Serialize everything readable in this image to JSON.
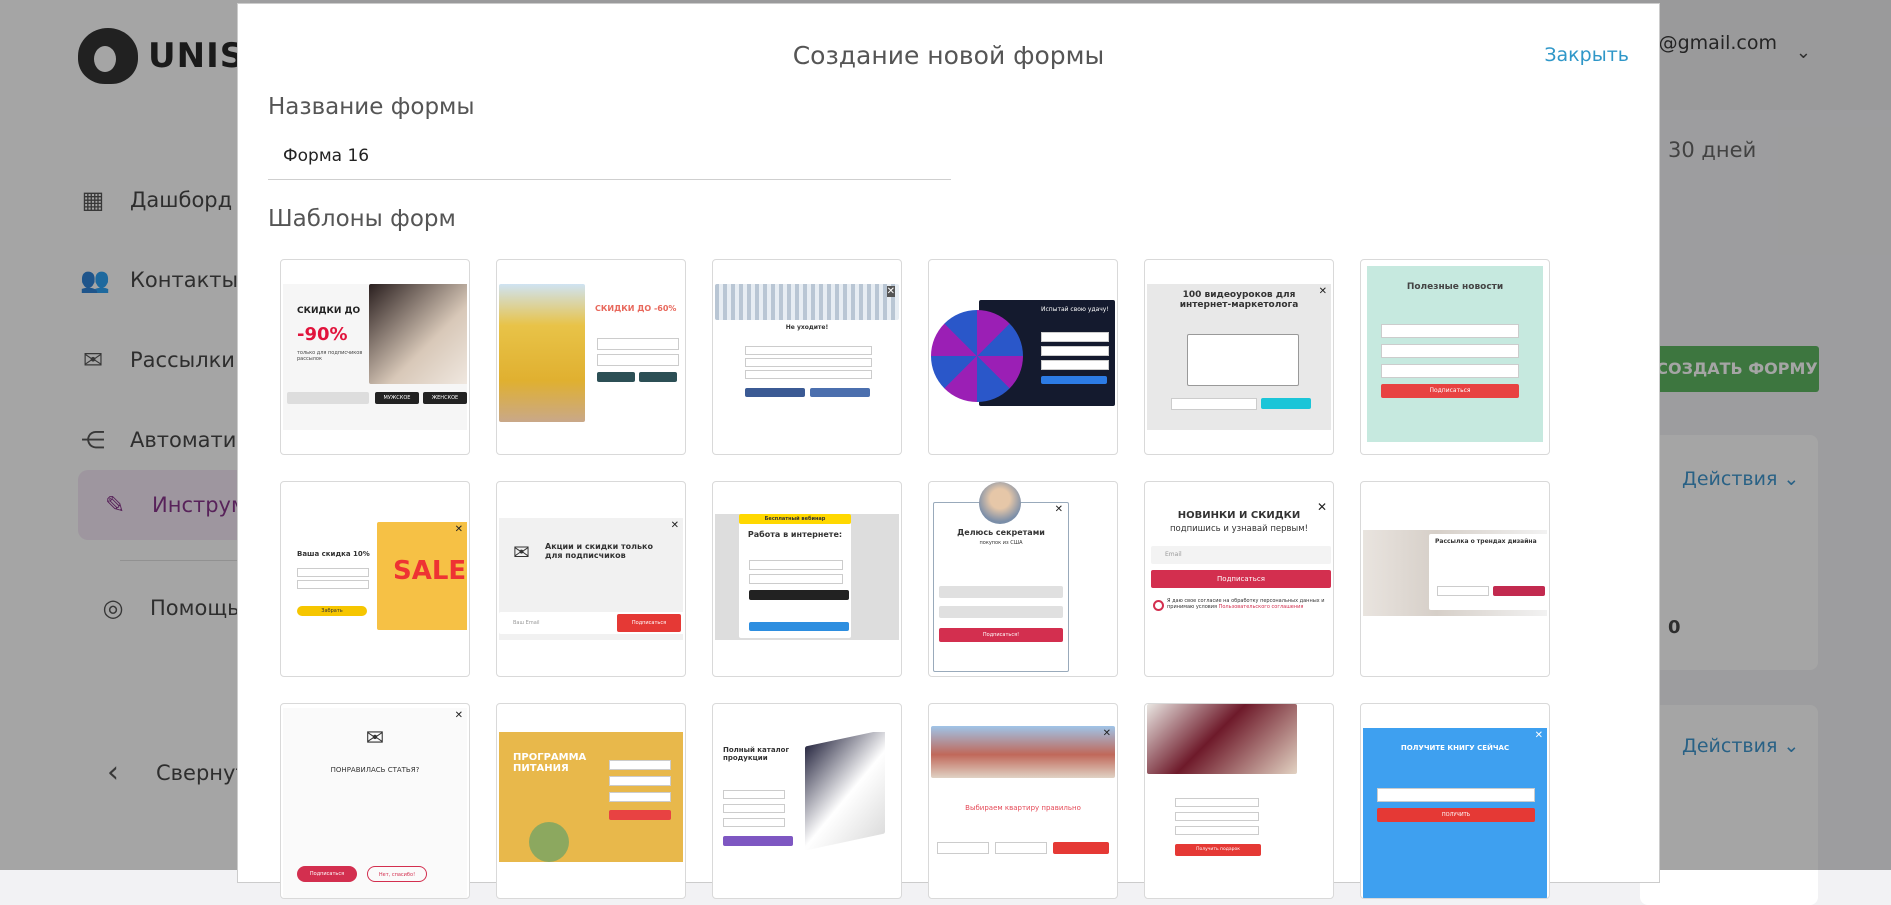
{
  "app": {
    "logo_text": "UNIS",
    "nav": [
      {
        "label": "Дашборд",
        "icon": "grid-icon"
      },
      {
        "label": "Контакты",
        "icon": "contacts-icon"
      },
      {
        "label": "Рассылки",
        "icon": "mail-icon"
      },
      {
        "label": "Автомати",
        "icon": "automation-icon"
      },
      {
        "label": "Инструм",
        "icon": "tools-icon"
      }
    ],
    "help_label": "Помощь",
    "collapse_label": "Свернут",
    "user_email": "ry@gmail.com",
    "period": "30 дней",
    "create_button": "СОЗДАТЬ ФОРМУ",
    "actions_label": "Действия",
    "zero_value": "0"
  },
  "modal": {
    "title": "Создание новой формы",
    "close_label": "Закрыть",
    "name_label": "Название формы",
    "name_value": "Форма 16",
    "templates_label": "Шаблоны форм"
  },
  "templates": {
    "t1": {
      "title": "СКИДКИ ДО",
      "percent": "-90%",
      "sub": "только для подписчиков рассылок",
      "btn1": "МУЖСКОЕ",
      "btn2": "ЖЕНСКОЕ"
    },
    "t2": {
      "title": "СКИДКИ ДО -60%"
    },
    "t3": {
      "title": "Не уходите!"
    },
    "t4": {
      "title": "Испытай свою удачу!"
    },
    "t5": {
      "title": "100 видеоуроков для интернет-маркетолога"
    },
    "t6": {
      "title": "Полезные новости",
      "btn": "Подписаться"
    },
    "t7": {
      "title": "Ваша скидка 10%",
      "sale": "SALE",
      "btn": "Забрать"
    },
    "t8": {
      "title": "Акции и скидки только для подписчиков",
      "placeholder": "Ваш Email",
      "btn": "Подписаться"
    },
    "t9": {
      "banner": "Бесплатный вебинар",
      "title": "Работа в интернете:"
    },
    "t10": {
      "title": "Делюсь секретами",
      "sub": "покупок из США",
      "btn": "Подписаться!"
    },
    "t11": {
      "title": "НОВИНКИ И СКИДКИ",
      "sub": "подпишись и узнавай первым!",
      "placeholder": "Email",
      "btn": "Подписаться",
      "consent": "Я даю свое согласие на обработку персональных данных и принимаю условия",
      "consent_link": "Пользовательского соглашения"
    },
    "t12": {
      "title": "Рассылка о трендах дизайна"
    },
    "t13": {
      "title": "ПОНРАВИЛАСЬ СТАТЬЯ?",
      "btn1": "Подписаться",
      "btn2": "Нет, спасибо!"
    },
    "t14": {
      "title": "ПРОГРАММА ПИТАНИЯ"
    },
    "t15": {
      "title": "Полный каталог продукции"
    },
    "t16": {
      "title": "Выбираем квартиру правильно"
    },
    "t17": {
      "btn": "Получить подарок"
    },
    "t18": {
      "title": "ПОЛУЧИТЕ КНИГУ СЕЙЧАС",
      "btn": "ПОЛУЧИТЬ"
    }
  }
}
